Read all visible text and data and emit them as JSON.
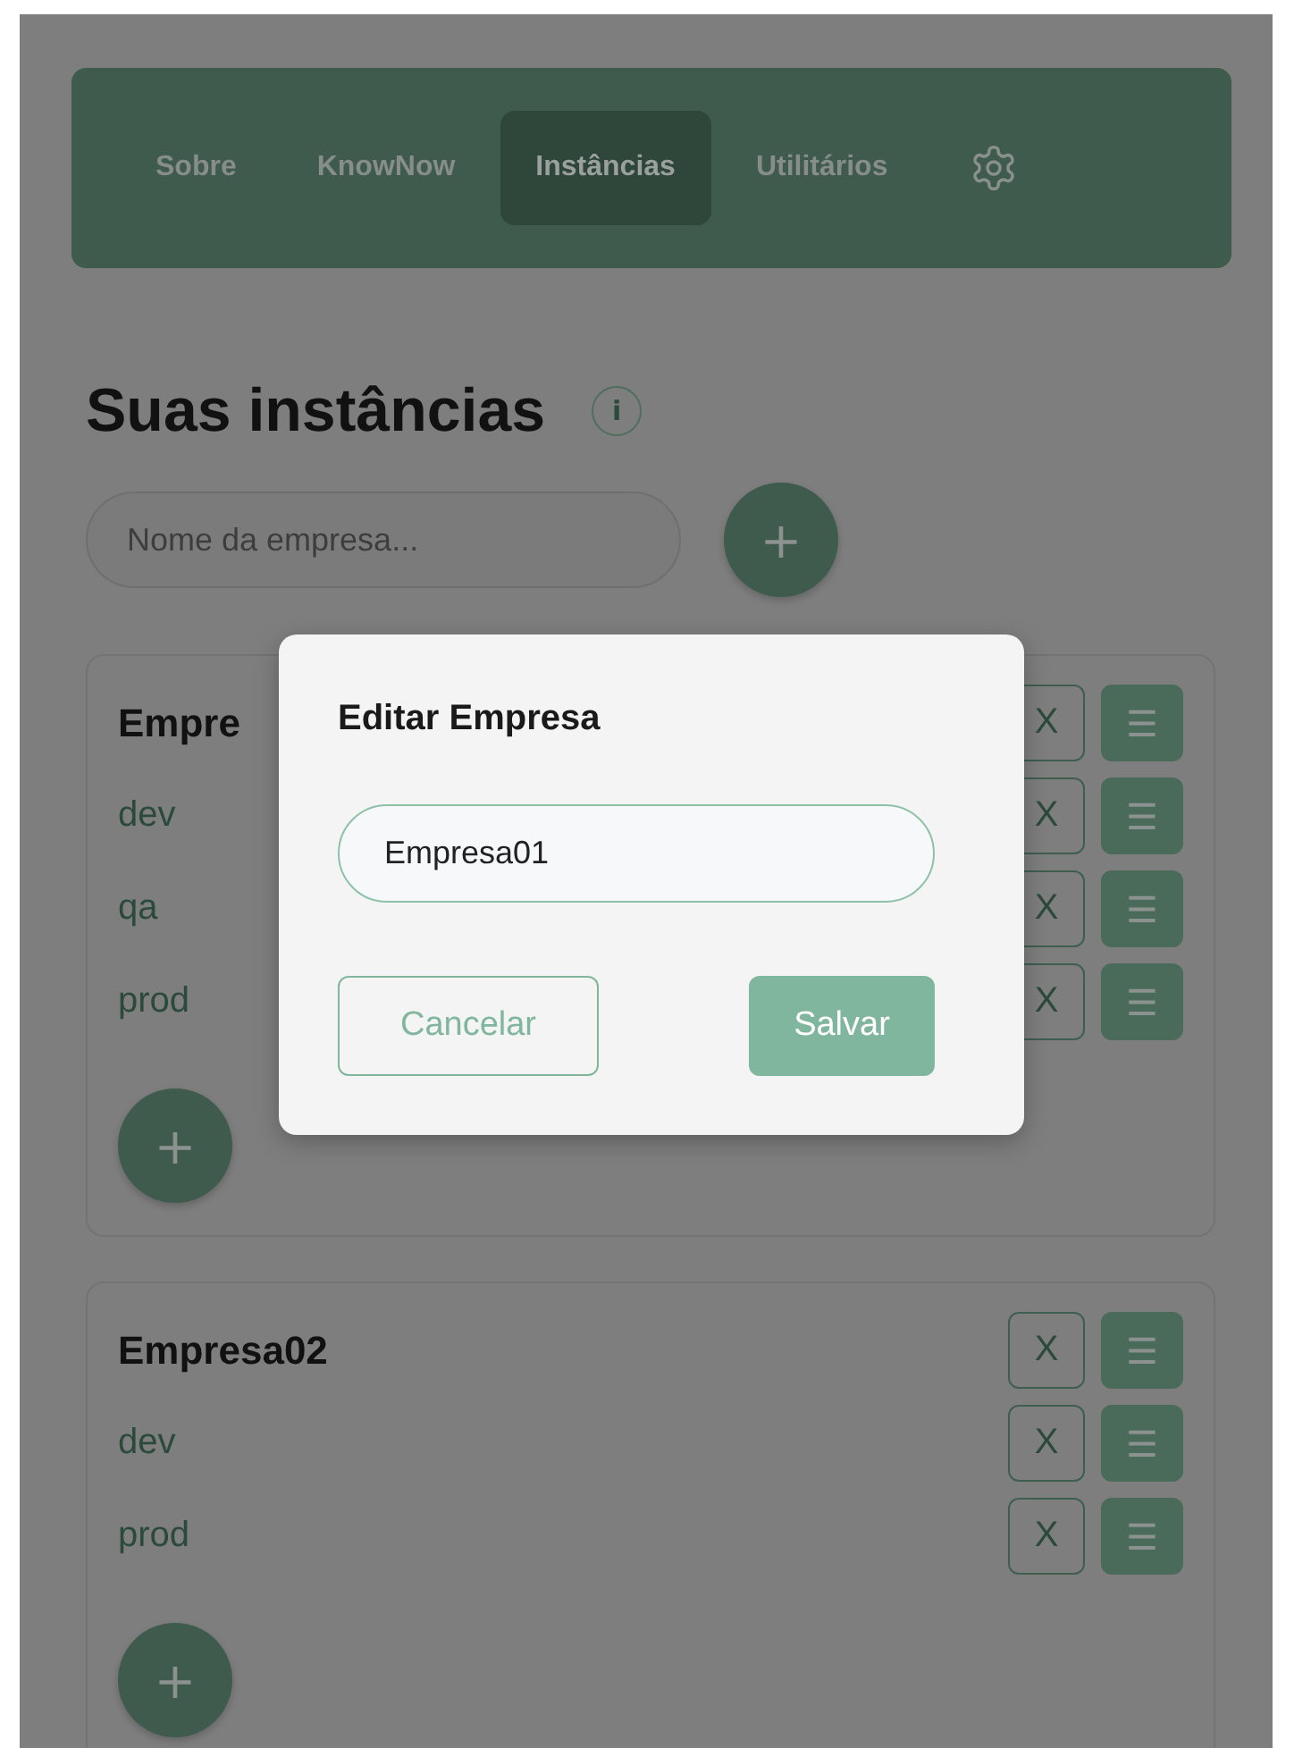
{
  "nav": {
    "tabs": [
      {
        "label": "Sobre",
        "selected": false
      },
      {
        "label": "KnowNow",
        "selected": false
      },
      {
        "label": "Instâncias",
        "selected": true
      },
      {
        "label": "Utilitários",
        "selected": false
      }
    ]
  },
  "heading": "Suas instâncias",
  "info": "i",
  "search": {
    "placeholder": "Nome da empresa..."
  },
  "add_button": "+",
  "companies": [
    {
      "name": "Empre",
      "delete": "X",
      "menu": "☰",
      "environments": [
        {
          "name": "dev",
          "delete": "X",
          "menu": "☰"
        },
        {
          "name": "qa",
          "delete": "X",
          "menu": "☰"
        },
        {
          "name": "prod",
          "delete": "X",
          "menu": "☰"
        }
      ],
      "add_button": "+"
    },
    {
      "name": "Empresa02",
      "delete": "X",
      "menu": "☰",
      "environments": [
        {
          "name": "dev",
          "delete": "X",
          "menu": "☰"
        },
        {
          "name": "prod",
          "delete": "X",
          "menu": "☰"
        }
      ],
      "add_button": "+"
    }
  ],
  "dialog": {
    "title": "Editar Empresa",
    "value": "Empresa01",
    "cancel": "Cancelar",
    "save": "Salvar"
  }
}
